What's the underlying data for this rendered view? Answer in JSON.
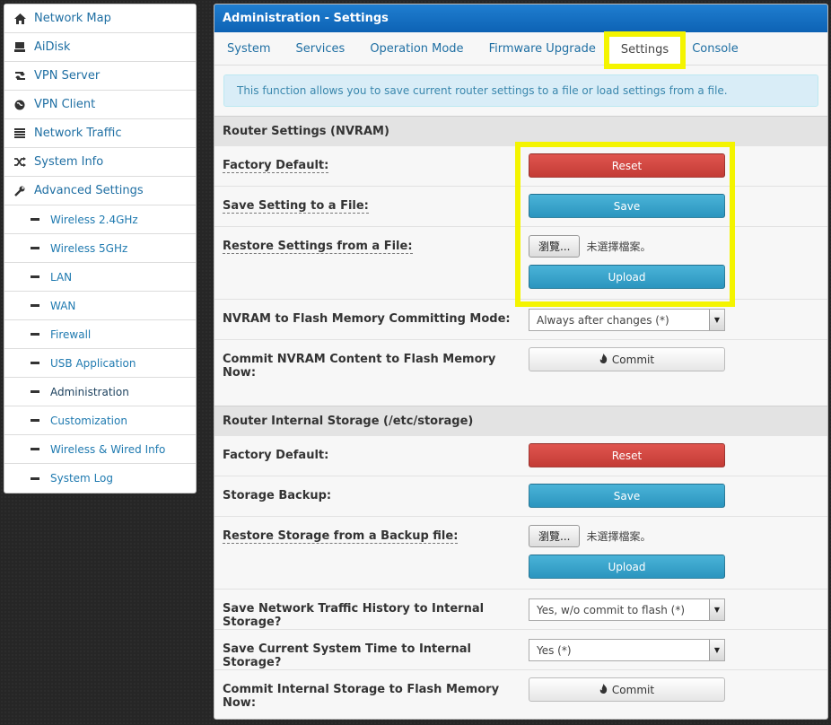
{
  "sidebar": {
    "items": [
      {
        "label": "Network Map",
        "icon": "home-icon"
      },
      {
        "label": "AiDisk",
        "icon": "drive-icon"
      },
      {
        "label": "VPN Server",
        "icon": "retweet-icon"
      },
      {
        "label": "VPN Client",
        "icon": "globe-icon"
      },
      {
        "label": "Network Traffic",
        "icon": "list-icon"
      },
      {
        "label": "System Info",
        "icon": "shuffle-icon"
      },
      {
        "label": "Advanced Settings",
        "icon": "wrench-icon"
      }
    ],
    "subitems": [
      "Wireless 2.4GHz",
      "Wireless 5GHz",
      "LAN",
      "WAN",
      "Firewall",
      "USB Application",
      "Administration",
      "Customization",
      "Wireless & Wired Info",
      "System Log"
    ]
  },
  "header": {
    "title": "Administration - Settings"
  },
  "tabs": [
    "System",
    "Services",
    "Operation Mode",
    "Firmware Upgrade",
    "Settings",
    "Console"
  ],
  "info": "This function allows you to save current router settings to a file or load settings from a file.",
  "nvram": {
    "title": "Router Settings (NVRAM)",
    "factory_label": "Factory Default:",
    "reset_label": "Reset",
    "save_file_label": "Save Setting to a File:",
    "save_label": "Save",
    "restore_label": "Restore Settings from a File:",
    "browse_label": "瀏覽...",
    "no_file_label": "未選擇檔案。",
    "upload_label": "Upload",
    "commit_mode_label": "NVRAM to Flash Memory Committing Mode:",
    "commit_mode_value": "Always after changes (*)",
    "commit_now_label": "Commit NVRAM Content to Flash Memory Now:",
    "commit_label": "Commit"
  },
  "storage": {
    "title": "Router Internal Storage (/etc/storage)",
    "factory_label": "Factory Default:",
    "reset_label": "Reset",
    "backup_label": "Storage Backup:",
    "save_label": "Save",
    "restore_label": "Restore Storage from a Backup file:",
    "browse_label": "瀏覽...",
    "no_file_label": "未選擇檔案。",
    "upload_label": "Upload",
    "traffic_label": "Save Network Traffic History to Internal Storage?",
    "traffic_value": "Yes, w/o commit to flash (*)",
    "time_label": "Save Current System Time to Internal Storage?",
    "time_value": "Yes (*)",
    "commit_now_label": "Commit Internal Storage to Flash Memory Now:",
    "commit_label": "Commit"
  },
  "colors": {
    "header_blue": "#1f7ed0",
    "danger_red": "#c33b35",
    "info_blue": "#2b95bf",
    "highlight_yellow": "#f4f400"
  }
}
